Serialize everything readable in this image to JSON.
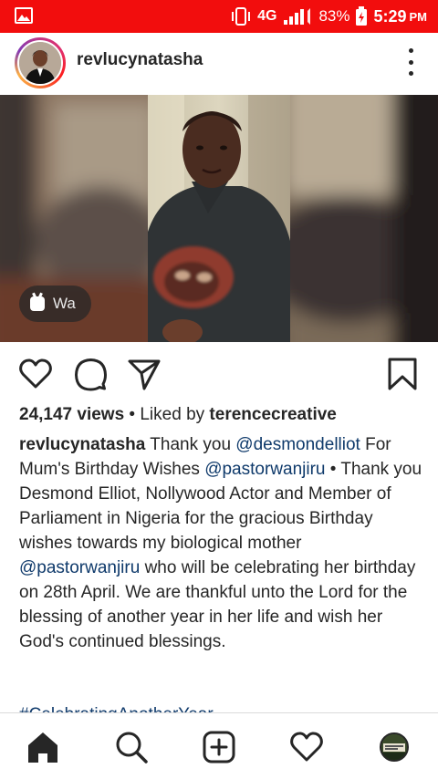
{
  "status_bar": {
    "network": "4G",
    "battery": "83%",
    "time": "5:29",
    "ampm": "PM",
    "colors": {
      "background": "#f20d0d",
      "foreground": "#ffffff"
    }
  },
  "post": {
    "username": "revlucynatasha",
    "media": {
      "overlay_label": "Wa"
    },
    "stats": {
      "views": "24,147 views",
      "separator": " • Liked by ",
      "liked_by": "terencecreative"
    },
    "caption": {
      "author": "revlucynatasha",
      "t1": " Thank you ",
      "m1": "@desmondelliot",
      "t2": " For Mum's Birthday Wishes ",
      "m2": "@pastorwanjiru",
      "t3": " • Thank you Desmond Elliot, Nollywood Actor and Member of Parliament in Nigeria for the gracious Birthday wishes towards my biological mother ",
      "m3": "@pastorwanjiru",
      "t4": " who will be celebrating her birthday on 28th April. We are thankful unto the Lord for the blessing of another year in her life and wish her God's continued blessings."
    },
    "hashtag": "#CelebratingAnotherYear"
  },
  "actions": [
    "heart-icon",
    "comment-icon",
    "share-icon",
    "bookmark-icon"
  ],
  "bottom_nav": [
    "home-icon",
    "search-icon",
    "new-post-icon",
    "activity-icon",
    "profile-avatar"
  ],
  "colors": {
    "text": "#262626",
    "mention": "#0f3a6b",
    "divider": "#dbdbdb"
  }
}
